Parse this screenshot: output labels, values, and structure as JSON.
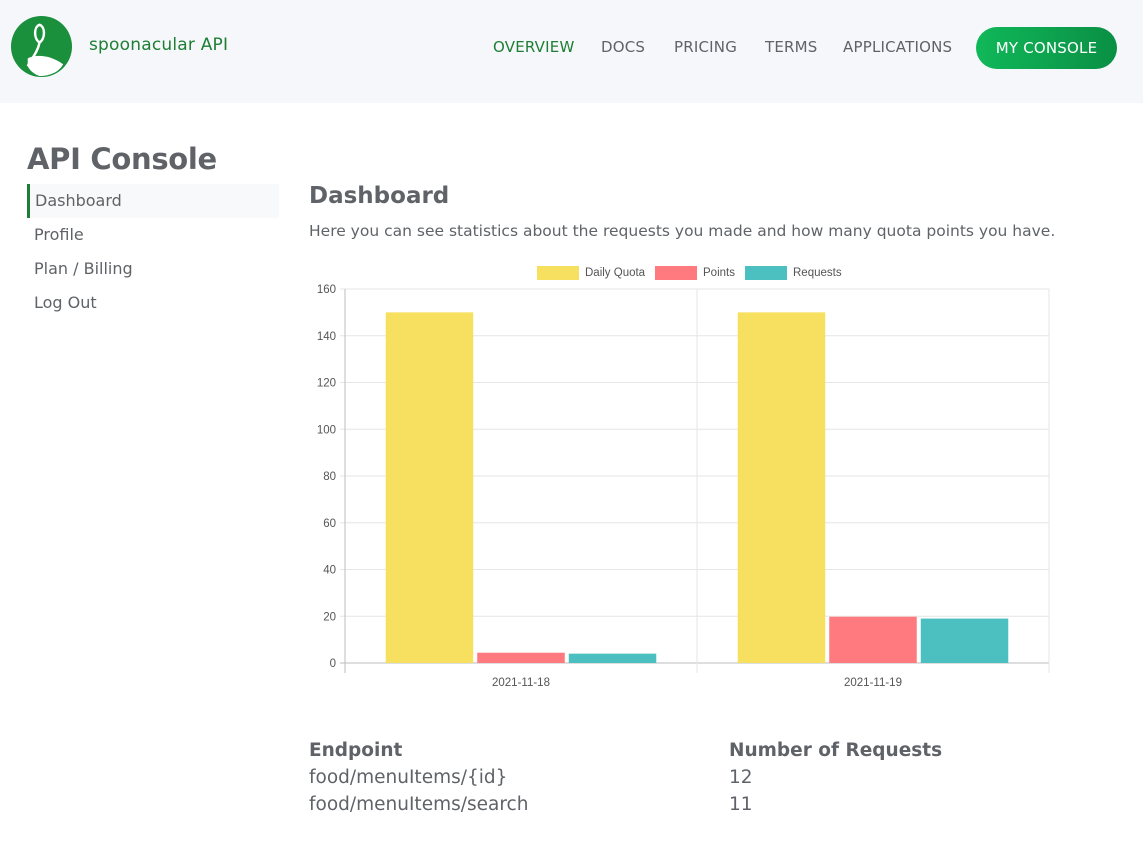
{
  "header": {
    "brand": "spoonacular API",
    "nav": [
      {
        "label": "OVERVIEW",
        "active": true
      },
      {
        "label": "DOCS",
        "active": false
      },
      {
        "label": "PRICING",
        "active": false
      },
      {
        "label": "TERMS",
        "active": false
      },
      {
        "label": "APPLICATIONS",
        "active": false
      }
    ],
    "console_button": "MY CONSOLE"
  },
  "sidebar": {
    "title": "API Console",
    "items": [
      {
        "label": "Dashboard",
        "active": true
      },
      {
        "label": "Profile",
        "active": false
      },
      {
        "label": "Plan / Billing",
        "active": false
      },
      {
        "label": "Log Out",
        "active": false
      }
    ]
  },
  "main": {
    "title": "Dashboard",
    "description": "Here you can see statistics about the requests you made and how many quota points you have."
  },
  "colors": {
    "brand_green": "#1e7e34",
    "button_green": "#0fae55",
    "daily_quota": "#f7df5f",
    "points": "#ff7a7e",
    "requests": "#4cc0c0"
  },
  "chart_data": {
    "type": "bar",
    "categories": [
      "2021-11-18",
      "2021-11-19"
    ],
    "series": [
      {
        "name": "Daily Quota",
        "color": "#f7df5f",
        "values": [
          150,
          150
        ]
      },
      {
        "name": "Points",
        "color": "#ff7a7e",
        "values": [
          4.4,
          19.8
        ]
      },
      {
        "name": "Requests",
        "color": "#4cc0c0",
        "values": [
          4,
          19
        ]
      }
    ],
    "ylim": [
      0,
      160
    ],
    "yticks": [
      0,
      20,
      40,
      60,
      80,
      100,
      120,
      140,
      160
    ],
    "grid": true,
    "legend": "top"
  },
  "table": {
    "headers": [
      "Endpoint",
      "Number of Requests"
    ],
    "rows": [
      [
        "food/menuItems/{id}",
        "12"
      ],
      [
        "food/menuItems/search",
        "11"
      ]
    ]
  }
}
